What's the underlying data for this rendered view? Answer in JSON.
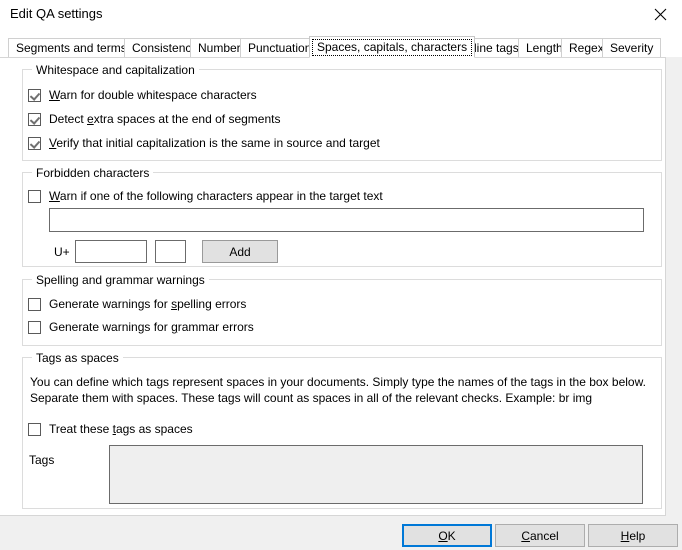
{
  "window": {
    "title": "Edit QA settings",
    "close_icon": "close-icon",
    "accent_color": "#0078d7",
    "panel_background": "#ffffff",
    "footer_background": "#f0f0f0"
  },
  "tabs": [
    {
      "label": "Segments and terms",
      "selected": false
    },
    {
      "label": "Consistency",
      "selected": false
    },
    {
      "label": "Numbers",
      "selected": false
    },
    {
      "label": "Punctuation",
      "selected": false
    },
    {
      "label": "Spaces, capitals, characters",
      "selected": true
    },
    {
      "label": "Inline tags",
      "selected": false
    },
    {
      "label": "Length",
      "selected": false
    },
    {
      "label": "Regex",
      "selected": false
    },
    {
      "label": "Severity",
      "selected": false
    }
  ],
  "groups": {
    "whitespace": {
      "title": "Whitespace and capitalization",
      "checkboxes": [
        {
          "label_before": "",
          "accel": "W",
          "label_after": "arn for double whitespace characters",
          "checked": true
        },
        {
          "label_before": "Detect ",
          "accel": "e",
          "label_after": "xtra spaces at the end of segments",
          "checked": true
        },
        {
          "label_before": "",
          "accel": "V",
          "label_after": "erify that initial capitalization is the same in source and target",
          "checked": true
        }
      ]
    },
    "forbidden": {
      "title": "Forbidden characters",
      "checkbox": {
        "label_before": "",
        "accel": "W",
        "label_after": "arn if one of the following characters appear in the target text",
        "checked": false
      },
      "chars_input_value": "",
      "unicode_prefix_label": "U+",
      "unicode_input_value": "",
      "unicode_char_value": "",
      "add_button_label": "Add"
    },
    "spelling": {
      "title": "Spelling and grammar warnings",
      "checkboxes": [
        {
          "label_before": "Generate warnings for ",
          "accel": "s",
          "label_after": "pelling errors",
          "checked": false
        },
        {
          "label_before": "Generate warnings for ",
          "accel": "g",
          "label_after": "rammar errors",
          "checked": false
        }
      ]
    },
    "tags_as_spaces": {
      "title": "Tags as spaces",
      "description_line1": "You can define which tags represent spaces in your documents. Simply type the names of the tags in the box below. Separate them",
      "description_line2": "with spaces. These tags will count as spaces in all of the relevant checks. Example: br img",
      "checkbox": {
        "label_before": "Treat these ",
        "accel": "t",
        "label_after": "ags as spaces",
        "checked": false
      },
      "tags_field_label": "Tags",
      "tags_field_value": ""
    }
  },
  "footer": {
    "ok": {
      "label_before": "",
      "accel": "O",
      "label_after": "K",
      "is_default": true
    },
    "cancel": {
      "label_before": "",
      "accel": "C",
      "label_after": "ancel",
      "is_default": false
    },
    "help": {
      "label_before": "",
      "accel": "H",
      "label_after": "elp",
      "is_default": false
    }
  }
}
